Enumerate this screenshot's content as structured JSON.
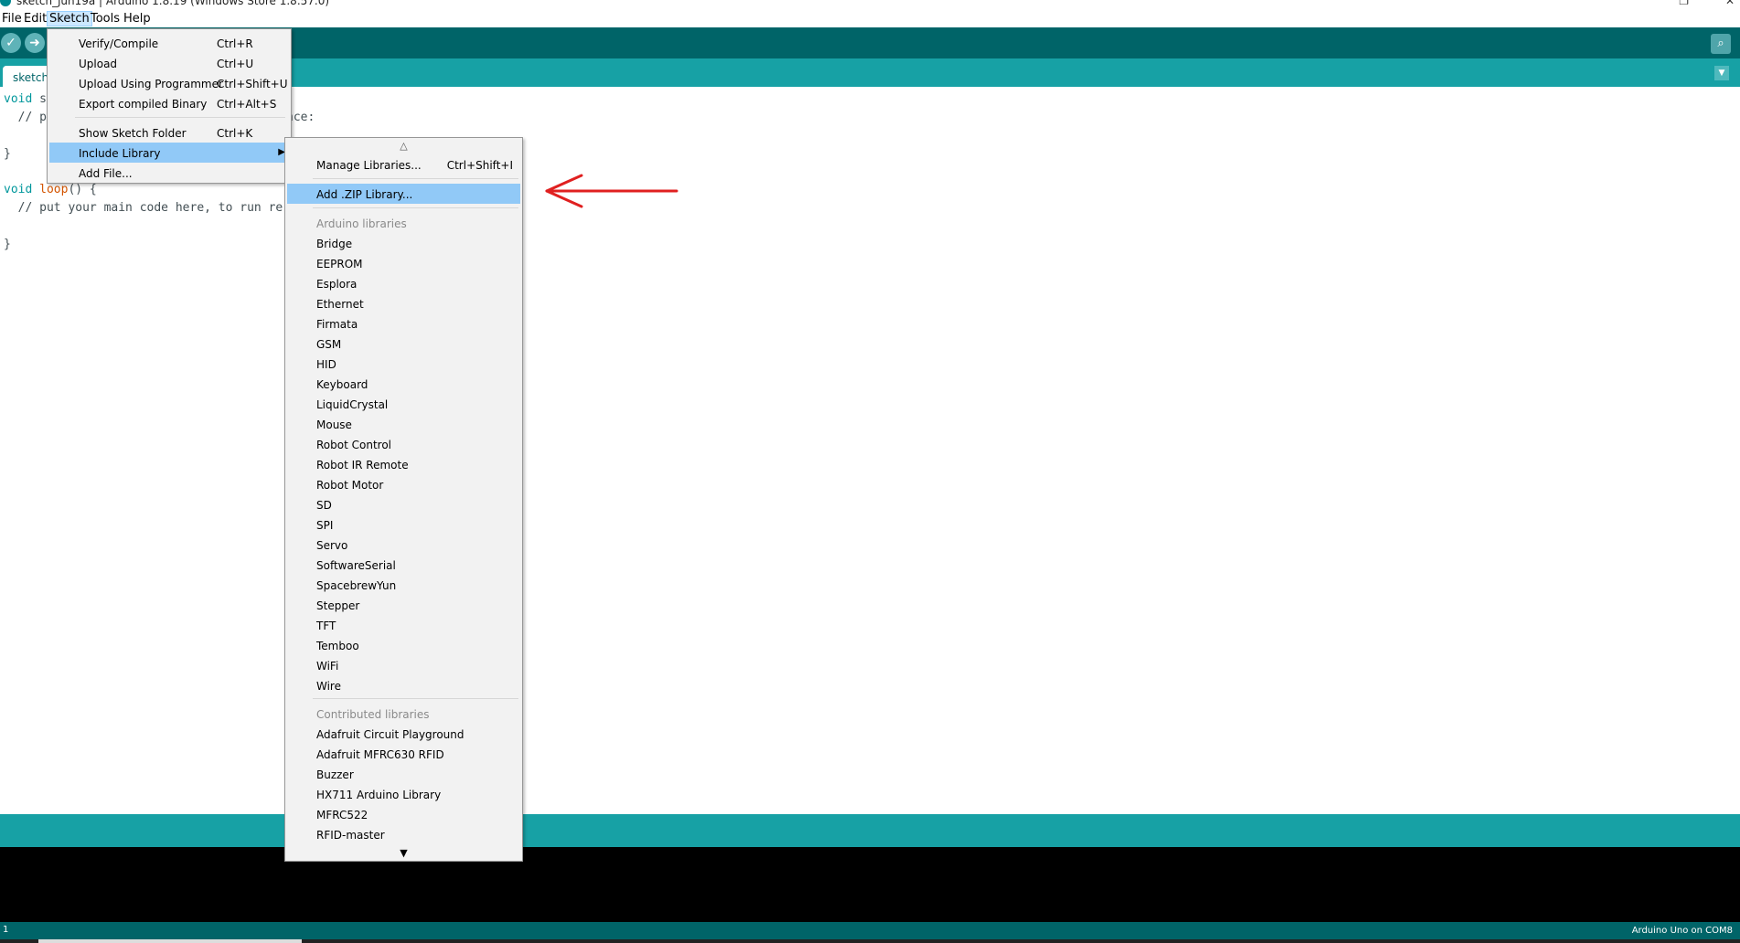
{
  "window": {
    "title": "sketch_jun19a | Arduino 1.8.19 (Windows Store 1.8.57.0)"
  },
  "menubar": {
    "items": [
      "File",
      "Edit",
      "Sketch",
      "Tools",
      "Help"
    ],
    "active": "Sketch"
  },
  "toolbar": {
    "buttons": [
      "verify-icon",
      "upload-icon"
    ],
    "serial_icon": "serial-monitor-icon",
    "color": "#006468",
    "tabstrip_color": "#17a1a5"
  },
  "tabs": [
    {
      "label": "sketch_"
    }
  ],
  "editor": {
    "lines": [
      {
        "a": "void",
        "b": " s",
        "c": ""
      },
      {
        "a": "",
        "b": "  // p",
        "c": ""
      },
      {
        "a": "",
        "b": "",
        "c": "nce:"
      },
      {
        "a": "",
        "b": "}",
        "c": ""
      },
      {
        "a": "void",
        "b": " loop",
        "c": "() {"
      },
      {
        "a": "",
        "b": "  // put your main code here, to run re",
        "c": ""
      },
      {
        "a": "",
        "b": "}",
        "c": ""
      }
    ]
  },
  "sketch_menu": {
    "items": [
      {
        "label": "Verify/Compile",
        "shortcut": "Ctrl+R"
      },
      {
        "label": "Upload",
        "shortcut": "Ctrl+U"
      },
      {
        "label": "Upload Using Programmer",
        "shortcut": "Ctrl+Shift+U"
      },
      {
        "label": "Export compiled Binary",
        "shortcut": "Ctrl+Alt+S"
      },
      {
        "label": "Show Sketch Folder",
        "shortcut": "Ctrl+K"
      },
      {
        "label": "Include Library",
        "shortcut": ""
      },
      {
        "label": "Add File...",
        "shortcut": ""
      }
    ],
    "highlighted": "Include Library"
  },
  "library_menu": {
    "manage": {
      "label": "Manage Libraries...",
      "shortcut": "Ctrl+Shift+I"
    },
    "add_zip": {
      "label": "Add .ZIP Library..."
    },
    "arduino_header": "Arduino libraries",
    "arduino_libraries": [
      "Bridge",
      "EEPROM",
      "Esplora",
      "Ethernet",
      "Firmata",
      "GSM",
      "HID",
      "Keyboard",
      "LiquidCrystal",
      "Mouse",
      "Robot Control",
      "Robot IR Remote",
      "Robot Motor",
      "SD",
      "SPI",
      "Servo",
      "SoftwareSerial",
      "SpacebrewYun",
      "Stepper",
      "TFT",
      "Temboo",
      "WiFi",
      "Wire"
    ],
    "contributed_header": "Contributed libraries",
    "contributed_libraries": [
      "Adafruit Circuit Playground",
      "Adafruit MFRC630 RFID",
      "Buzzer",
      "HX711 Arduino Library",
      "MFRC522",
      "RFID-master"
    ]
  },
  "status": {
    "line_number": "1",
    "board": "Arduino Uno on COM8"
  },
  "annotation": {
    "arrow_color": "#e02020"
  }
}
